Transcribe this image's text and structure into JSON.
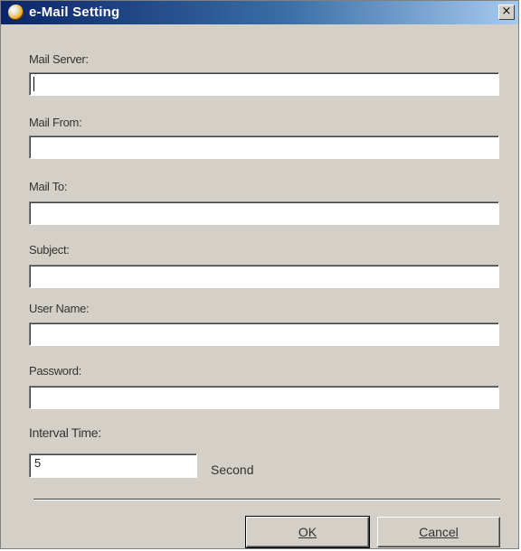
{
  "window": {
    "title": "e-Mail Setting",
    "close_glyph": "×"
  },
  "form": {
    "mail_server_label": "Mail Server:",
    "mail_server_value": "",
    "mail_from_label": "Mail From:",
    "mail_from_value": "",
    "mail_to_label": "Mail To:",
    "mail_to_value": "",
    "subject_label": "Subject:",
    "subject_value": "",
    "user_name_label": "User Name:",
    "user_name_value": "",
    "password_label": "Password:",
    "password_value": "",
    "interval_label": "Interval Time:",
    "interval_value": "5",
    "interval_unit": "Second"
  },
  "buttons": {
    "ok_label": "OK",
    "cancel_label": "Cancel"
  },
  "icons": {
    "app_icon": "app-globe-icon",
    "close_icon": "close-icon"
  }
}
